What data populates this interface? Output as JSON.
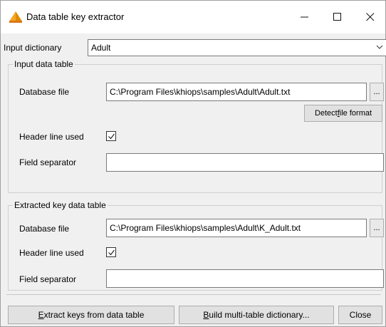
{
  "window": {
    "title": "Data table key extractor",
    "controls": {
      "minimize": "—",
      "maximize": "☐",
      "close": "✕"
    }
  },
  "dictionary": {
    "label": "Input dictionary",
    "selected": "Adult"
  },
  "input_table": {
    "title": "Input data table",
    "database_file_label": "Database file",
    "database_file_value": "C:\\Program Files\\khiops\\samples\\Adult\\Adult.txt",
    "browse_label": "...",
    "detect_button": {
      "pre": "Detect ",
      "accel": "f",
      "post": "ile format"
    },
    "header_line_label": "Header line used",
    "header_line_checked": true,
    "field_separator_label": "Field separator",
    "field_separator_value": ""
  },
  "extracted_table": {
    "title": "Extracted key data table",
    "database_file_label": "Database file",
    "database_file_value": "C:\\Program Files\\khiops\\samples\\Adult\\K_Adult.txt",
    "browse_label": "...",
    "header_line_label": "Header line used",
    "header_line_checked": true,
    "field_separator_label": "Field separator",
    "field_separator_value": ""
  },
  "footer": {
    "extract_button": {
      "accel": "E",
      "post": "xtract keys from data table"
    },
    "build_button": {
      "accel": "B",
      "post": "uild multi-table dictionary..."
    },
    "close_button": "Close"
  },
  "colors": {
    "window_bg": "#f0f0f0",
    "titlebar_bg": "#ffffff",
    "icon_orange": "#f5a623"
  },
  "icons": {
    "app": "khiops-app-icon",
    "dropdown": "chevron-down-icon",
    "check": "checkmark-icon"
  }
}
